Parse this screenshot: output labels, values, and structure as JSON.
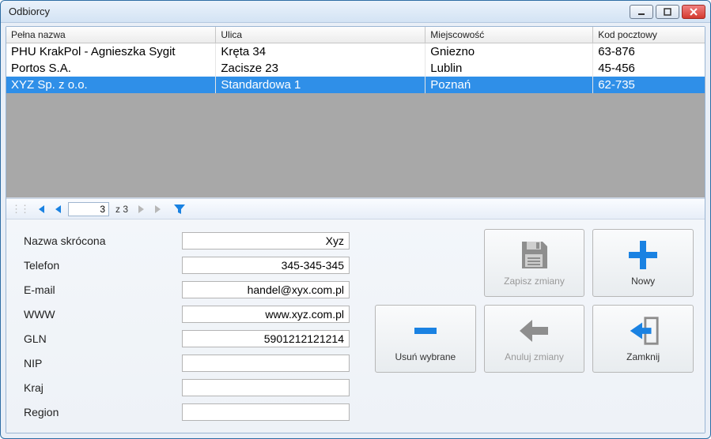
{
  "window": {
    "title": "Odbiorcy"
  },
  "table": {
    "headers": [
      "Pełna nazwa",
      "Ulica",
      "Miejscowość",
      "Kod pocztowy"
    ],
    "rows": [
      {
        "cells": [
          "PHU KrakPol - Agnieszka Sygit",
          "Kręta 34",
          "Gniezno",
          "63-876"
        ],
        "selected": false
      },
      {
        "cells": [
          "Portos S.A.",
          "Zacisze 23",
          "Lublin",
          "45-456"
        ],
        "selected": false
      },
      {
        "cells": [
          "XYZ Sp. z o.o.",
          "Standardowa 1",
          "Poznań",
          "62-735"
        ],
        "selected": true
      }
    ]
  },
  "nav": {
    "page": "3",
    "total_prefix": "z",
    "total": "3"
  },
  "form": {
    "labels": {
      "short_name": "Nazwa skrócona",
      "phone": "Telefon",
      "email": "E-mail",
      "www": "WWW",
      "gln": "GLN",
      "nip": "NIP",
      "country": "Kraj",
      "region": "Region"
    },
    "values": {
      "short_name": "Xyz",
      "phone": "345-345-345",
      "email": "handel@xyx.com.pl",
      "www": "www.xyz.com.pl",
      "gln": "5901212121214",
      "nip": "",
      "country": "",
      "region": ""
    }
  },
  "buttons": {
    "save": "Zapisz zmiany",
    "new": "Nowy",
    "delete": "Usuń wybrane",
    "cancel": "Anuluj zmiany",
    "close": "Zamknij"
  }
}
